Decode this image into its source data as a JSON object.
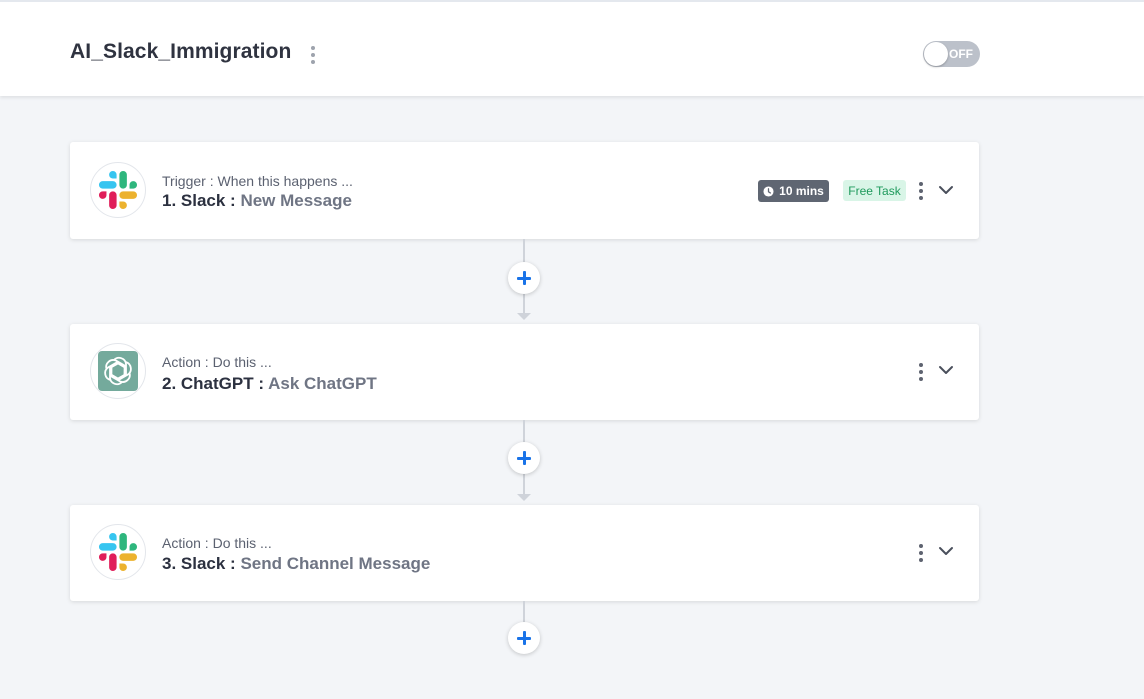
{
  "workflow": {
    "title": "AI_Slack_Immigration",
    "toggle_label": "OFF"
  },
  "steps": [
    {
      "subtitle": "Trigger : When this happens ...",
      "number_app": "1. Slack : ",
      "event": "New Message",
      "icon": "slack-logo",
      "time_badge": "10 mins",
      "task_badge": "Free Task"
    },
    {
      "subtitle": "Action : Do this ...",
      "number_app": "2. ChatGPT : ",
      "event": "Ask ChatGPT",
      "icon": "chatgpt-logo"
    },
    {
      "subtitle": "Action : Do this ...",
      "number_app": "3. Slack : ",
      "event": "Send Channel Message",
      "icon": "slack-logo"
    }
  ],
  "colors": {
    "accent": "#1a73e8",
    "toggle_off": "#bcc1ca",
    "time_badge_bg": "#5f6672",
    "free_badge_bg": "#d9f5e7",
    "free_badge_text": "#1f9a5c",
    "chatgpt_bg": "#74aa9c",
    "slack_blue": "#36c5f0",
    "slack_green": "#2eb67d",
    "slack_yellow": "#ecb22e",
    "slack_red": "#e01e5a"
  }
}
